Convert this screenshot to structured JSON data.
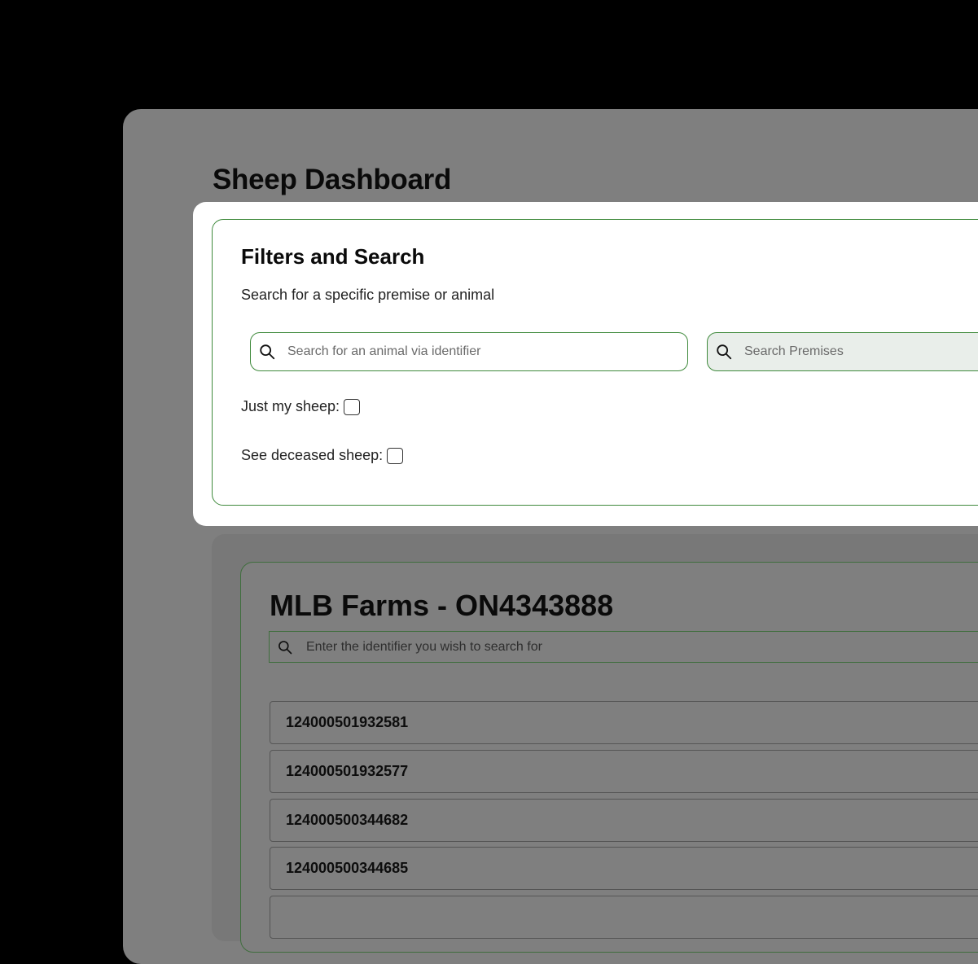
{
  "page": {
    "title": "Sheep Dashboard"
  },
  "filters": {
    "title": "Filters and Search",
    "subtitle": "Search for a specific premise or animal",
    "animal_search_placeholder": "Search for an animal via identifier",
    "premises_search_placeholder": "Search Premises",
    "just_my_sheep_label": "Just my sheep:",
    "deceased_sheep_label": "See deceased sheep:"
  },
  "farm": {
    "title": "MLB Farms - ON4343888",
    "search_placeholder": "Enter the identifier you wish to search for",
    "animals": [
      "124000501932581",
      "124000501932577",
      "124000500344682",
      "124000500344685"
    ]
  },
  "icons": {
    "search": "search-icon",
    "checkbox": "checkbox-icon"
  },
  "colors": {
    "accent_green": "#3f8a3c",
    "overlay": "#7f7f7f",
    "background": "#000000"
  }
}
